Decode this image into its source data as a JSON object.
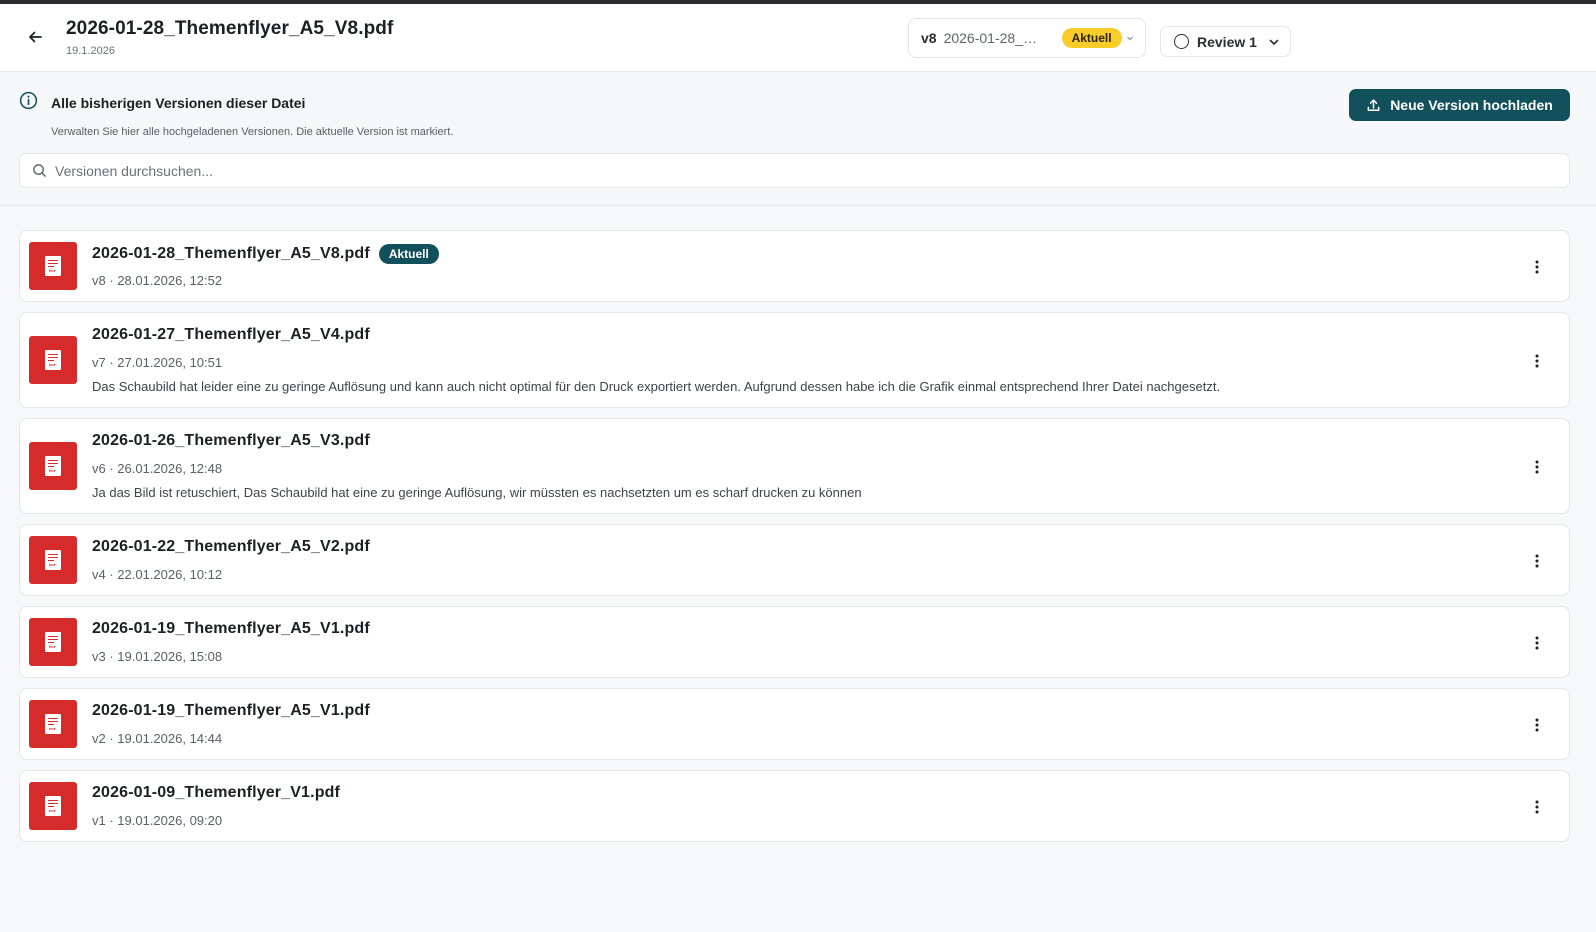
{
  "header": {
    "back_icon": "arrow-left-icon",
    "title": "2026-01-28_Themenflyer_A5_V8.pdf",
    "date": "19.1.2026",
    "version_select": {
      "version": "v8",
      "name": "2026-01-28_…",
      "badge": "Aktuell",
      "badge_color": "#f8cd2a"
    },
    "review_select": {
      "label": "Review 1"
    }
  },
  "info": {
    "icon": "info-circle-icon",
    "title": "Alle bisherigen Versionen dieser Datei",
    "subtitle": "Verwalten Sie hier alle hochgeladenen Versionen. Die aktuelle Version ist markiert.",
    "upload_button": "Neue Version hochladen",
    "upload_color": "#12505c",
    "search_placeholder": "Versionen durchsuchen..."
  },
  "versions": [
    {
      "name": "2026-01-28_Themenflyer_A5_V8.pdf",
      "badge": "Aktuell",
      "meta": "v8 · 28.01.2026, 12:52",
      "comment": ""
    },
    {
      "name": "2026-01-27_Themenflyer_A5_V4.pdf",
      "badge": "",
      "meta": "v7 · 27.01.2026, 10:51",
      "comment": "Das Schaubild hat leider eine zu geringe Auflösung und kann auch nicht optimal für den Druck exportiert werden. Aufgrund dessen habe ich die Grafik einmal entsprechend Ihrer Datei nachgesetzt."
    },
    {
      "name": "2026-01-26_Themenflyer_A5_V3.pdf",
      "badge": "",
      "meta": "v6 · 26.01.2026, 12:48",
      "comment": "Ja das Bild ist retuschiert, Das Schaubild hat eine zu geringe Auflösung, wir müssten es nachsetzten um es scharf drucken zu können"
    },
    {
      "name": "2026-01-22_Themenflyer_A5_V2.pdf",
      "badge": "",
      "meta": "v4 · 22.01.2026, 10:12",
      "comment": ""
    },
    {
      "name": "2026-01-19_Themenflyer_A5_V1.pdf",
      "badge": "",
      "meta": "v3 · 19.01.2026, 15:08",
      "comment": ""
    },
    {
      "name": "2026-01-19_Themenflyer_A5_V1.pdf",
      "badge": "",
      "meta": "v2 · 19.01.2026, 14:44",
      "comment": ""
    },
    {
      "name": "2026-01-09_Themenflyer_V1.pdf",
      "badge": "",
      "meta": "v1 · 19.01.2026, 09:20",
      "comment": ""
    }
  ],
  "pdf_icon_label": "PDF",
  "pdf_color": "#d62b2b"
}
